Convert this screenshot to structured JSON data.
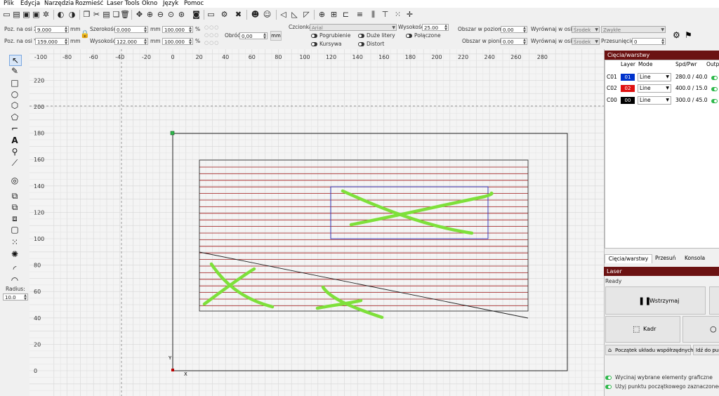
{
  "menu": [
    "Plik",
    "Edycja",
    "Narzędzia",
    "Rozmieść",
    "Laser Tools",
    "Okno",
    "Język",
    "Pomoc"
  ],
  "colors": {
    "panel_title": "#6b1212",
    "selection_green": "#2db84a",
    "layer_c01": "#0033cc",
    "layer_c02": "#e01010",
    "layer_c00": "#000000",
    "scribble": "#7ee03a",
    "scan_line": "#a01818",
    "workspace_border": "#222222"
  },
  "props": {
    "pos_x_label": "Poz. na osi X",
    "pos_x": "9.000",
    "pos_y_label": "Poz. na osi Y",
    "pos_y": "159.000",
    "unit": "mm",
    "width_label": "Szerokość",
    "width": "0.000",
    "height_label": "Wysokość",
    "height": "122.000",
    "pct_w": "100.000",
    "pct_h": "100.000",
    "pct": "%",
    "rotate_label": "Obróć",
    "rotate": "0,00",
    "mm_button": "mm",
    "font_label": "Czcionka",
    "font": "Arial",
    "font_height_label": "Wysokość",
    "font_height": "25.00",
    "bold": "Pogrubienie",
    "italic": "Kursywa",
    "upper": "Duże litery",
    "distort": "Distort",
    "joined": "Połączone",
    "hspace_label": "Obszar w poziomie",
    "hspace": "0.00",
    "vspace_label": "Obszar w pionie",
    "vspace": "0.00",
    "align_x_label": "Wyrównaj w osi X",
    "align_x": "Środek",
    "align_y_label": "Wyrównaj w osi Y",
    "align_y": "Środek",
    "style": "Zwykłe",
    "offset_label": "Przesunięcie",
    "offset": "0"
  },
  "left": {
    "radius_label": "Radius:",
    "radius": "10.0"
  },
  "canvas": {
    "top_ticks": [
      "-100",
      "-80",
      "-60",
      "-40",
      "-20",
      "0",
      "20",
      "40",
      "60",
      "80",
      "100",
      "120",
      "140",
      "160",
      "180",
      "200",
      "220",
      "240",
      "260",
      "280"
    ],
    "left_ticks": [
      "220",
      "200",
      "180",
      "160",
      "140",
      "120",
      "100",
      "80",
      "60",
      "40",
      "20",
      "0"
    ],
    "axis_x": "X",
    "axis_y": "Y"
  },
  "cuts": {
    "title": "Cięcia/warstwy",
    "headers": {
      "layer": "Layer",
      "mode": "Mode",
      "spd": "Spd/Pwr",
      "output": "Outp"
    },
    "rows": [
      {
        "id": "C01",
        "num": "01",
        "mode": "Line",
        "spd": "280.0 / 40.0"
      },
      {
        "id": "C02",
        "num": "02",
        "mode": "Line",
        "spd": "400.0 / 15.0"
      },
      {
        "id": "C00",
        "num": "00",
        "mode": "Line",
        "spd": "300.0 / 45.0"
      }
    ],
    "tabs": [
      "Cięcia/warstwy",
      "Przesuń",
      "Konsola"
    ]
  },
  "laser": {
    "title": "Laser",
    "status": "Ready",
    "pause": "Wstrzymaj",
    "frame": "Kadr",
    "origin": "Początek układu współrzędnych",
    "goto": "Idź do pun",
    "cut_selected": "Wycinaj wybrane elementy graficzne",
    "use_origin": "Użyj punktu początkowego zaznaczonego obi"
  }
}
